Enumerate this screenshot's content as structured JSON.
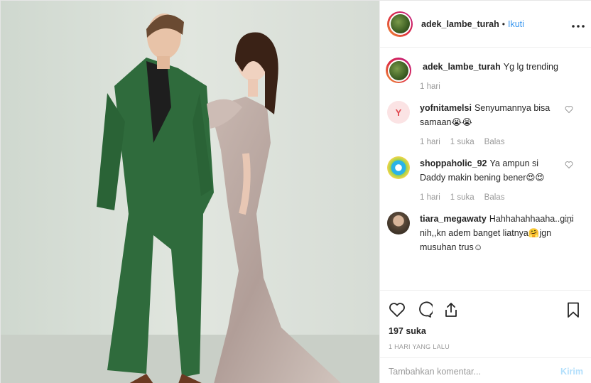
{
  "post": {
    "author": "adek_lambe_turah",
    "follow_label": "Ikuti",
    "separator": "•",
    "more_label": "•••",
    "caption": {
      "user": "adek_lambe_turah",
      "text": "Yg lg trending",
      "time": "1 hari"
    },
    "photo_alt": "Man in green suit and woman in sequined gown",
    "likes": "197 suka",
    "posted_ago": "1 HARI YANG LALU"
  },
  "comments": [
    {
      "user": "yofnitamelsi",
      "text": "Senyumannya bisa samaan😭😭",
      "time": "1 hari",
      "likes": "1 suka",
      "reply": "Balas",
      "avatar_letter": "Y",
      "avatar_color": "#e0484f"
    },
    {
      "user": "shoppaholic_92",
      "text": "Ya ampun si Daddy makin bening bener😍😍",
      "time": "1 hari",
      "likes": "1 suka",
      "reply": "Balas",
      "avatar_color": "#2ab3e8"
    },
    {
      "user": "tiara_megawaty",
      "text": "Hahhahahhaaha..gini nih,,kn adem banget liatnya🤗jgn musuhan trus☺",
      "avatar_color": "#6b5b4a"
    }
  ],
  "add_comment": {
    "placeholder": "Tambahkan komentar...",
    "post_label": "Kirim"
  },
  "icons": {
    "like": "heart-icon",
    "comment": "comment-icon",
    "share": "share-icon",
    "save": "bookmark-icon"
  }
}
